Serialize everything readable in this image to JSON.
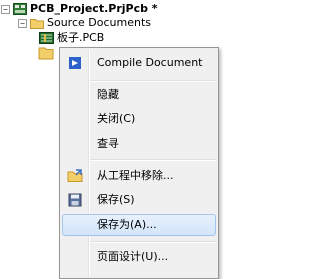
{
  "tree": {
    "project_label": "PCB_Project.PrjPcb *",
    "folder_label": "Source Documents",
    "pcb_file_label": "板子.PCB",
    "expander_collapse": "−"
  },
  "menu": {
    "items": [
      {
        "label": "Compile Document"
      },
      {
        "label": "隐藏"
      },
      {
        "label": "关闭(C)"
      },
      {
        "label": "查寻"
      },
      {
        "label": "从工程中移除..."
      },
      {
        "label": "保存(S)"
      },
      {
        "label": "保存为(A)..."
      },
      {
        "label": "页面设计(U)..."
      }
    ]
  }
}
